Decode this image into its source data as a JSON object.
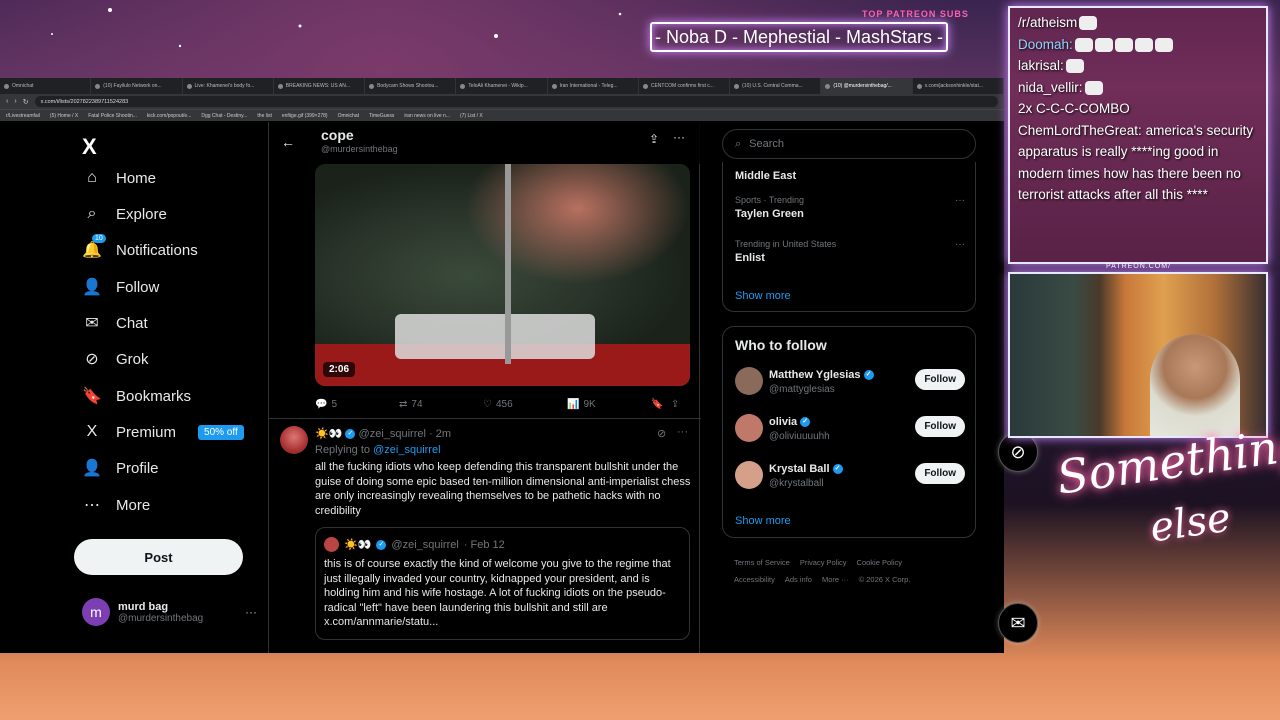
{
  "overlay": {
    "banner_label": "TOP PATREON SUBS",
    "banner_text": "- Noba D - Mephestial - MashStars -",
    "patreon_url": "PATREON.COM/",
    "brand_line1": "Something",
    "brand_line2": "else"
  },
  "browser": {
    "tabs": [
      "Omnichat",
      "(10) Fayilulo Network on...",
      "Live: Khamenei's body fo...",
      "BREAKING NEWS: US AN...",
      "Bodycam Shows Shootou...",
      "TeloAli Khamenei - Wikip...",
      "Iran International - Teleg...",
      "CENTCOM confirms first c...",
      "(10) U.S. Central Comma...",
      "(10) @murdersinthebag/...",
      "x.com/jacksonhinkle/stat..."
    ],
    "url": "x.com/i/lists/2027822389711524283",
    "bookmarks": [
      "r/Livestreamfail",
      "(5) Home / X",
      "Fatal Police Shootin...",
      "kick.com/popout/e...",
      "Dgg Chat - Destiny...",
      "the list",
      "enfiige.gif (399×278)",
      "Omnichat",
      "TimeGuess",
      "iran news on live n...",
      "(7) List / X"
    ]
  },
  "sidebar": {
    "logo": "X",
    "items": [
      {
        "label": "Home",
        "icon": "⌂"
      },
      {
        "label": "Explore",
        "icon": "⌕"
      },
      {
        "label": "Notifications",
        "icon": "🔔",
        "badge": "10"
      },
      {
        "label": "Follow",
        "icon": "👤"
      },
      {
        "label": "Chat",
        "icon": "✉"
      },
      {
        "label": "Grok",
        "icon": "⊘"
      },
      {
        "label": "Bookmarks",
        "icon": "🔖"
      },
      {
        "label": "Premium",
        "icon": "X",
        "tag": "50% off"
      },
      {
        "label": "Profile",
        "icon": "👤"
      },
      {
        "label": "More",
        "icon": "⋯"
      }
    ],
    "post_label": "Post",
    "account": {
      "avatar_letter": "m",
      "name": "murd bag",
      "handle": "@murdersinthebag"
    }
  },
  "timeline": {
    "title": "cope",
    "handle": "@murdersinthebag",
    "video_duration": "2:06",
    "first_actions": {
      "replies": "5",
      "reposts": "74",
      "likes": "456",
      "views": "9K"
    },
    "tweet": {
      "name": "☀️👀",
      "handle": "@zei_squirrel",
      "time": "· 2m",
      "replying_prefix": "Replying to",
      "replying_to": "@zei_squirrel",
      "body": "all the fucking idiots who keep defending this transparent bullshit under the guise of doing some epic based ten-million dimensional anti-imperialist chess are only increasingly revealing themselves to be pathetic hacks with no credibility",
      "quote": {
        "name": "☀️👀",
        "handle": "@zei_squirrel",
        "date": "· Feb 12",
        "body": "this is of course exactly the kind of welcome you give to the regime that just illegally invaded your country, kidnapped your president, and is holding him and his wife hostage. A lot of fucking idiots on the pseudo-radical \"left\" have been laundering this bullshit and still are x.com/annmarie/statu..."
      }
    }
  },
  "right": {
    "search_placeholder": "Search",
    "trends": [
      {
        "category": "",
        "name": "Middle East"
      },
      {
        "category": "Sports · Trending",
        "name": "Taylen Green"
      },
      {
        "category": "Trending in United States",
        "name": "Enlist"
      }
    ],
    "show_more": "Show more",
    "who_to_follow_title": "Who to follow",
    "people": [
      {
        "name": "Matthew Yglesias",
        "handle": "@mattyglesias",
        "color": "#8a6a5a"
      },
      {
        "name": "olivia",
        "handle": "@oliviuuuuhh",
        "color": "#c0786a"
      },
      {
        "name": "Krystal Ball",
        "handle": "@krystalball",
        "color": "#d4a08a"
      }
    ],
    "follow_label": "Follow",
    "footer": [
      "Terms of Service",
      "Privacy Policy",
      "Cookie Policy",
      "Accessibility",
      "Ads info",
      "More ···",
      "© 2026 X Corp."
    ]
  },
  "stream_chat": [
    {
      "user": "/r/atheism",
      "msg": "",
      "emotes": 1,
      "blue": false
    },
    {
      "user": "Doomah:",
      "msg": "",
      "emotes": 5,
      "blue": true
    },
    {
      "user": "lakrisal:",
      "msg": "",
      "emotes": 1,
      "blue": false
    },
    {
      "user": "nida_vellir:",
      "msg": "",
      "emotes": 1,
      "blue": false
    },
    {
      "user": "2x",
      "msg": "C-C-C-COMBO",
      "emotes": 0,
      "blue": false
    },
    {
      "user": "ChemLordTheGreat:",
      "msg": "america's security apparatus is really ****ing good in modern times  how has there been no terrorist attacks after all this ****",
      "emotes": 0,
      "blue": false
    }
  ]
}
